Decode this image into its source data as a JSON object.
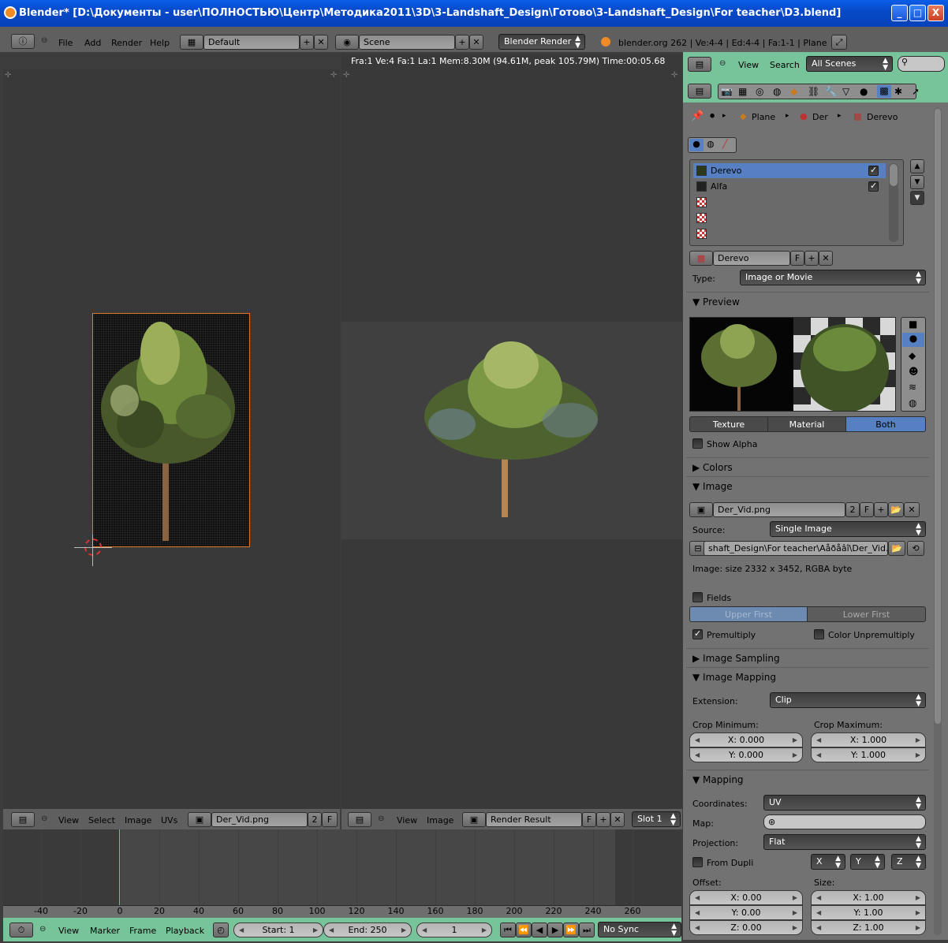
{
  "window": {
    "title": "Blender* [D:\\Документы - user\\ПОЛНОСТЬЮ\\Центр\\Методика2011\\3D\\3-Landshaft_Design\\Готово\\3-Landshaft_Design\\For teacher\\D3.blend]",
    "min": "_",
    "max": "□",
    "close": "X"
  },
  "info_header": {
    "menus": [
      "File",
      "Add",
      "Render",
      "Help"
    ],
    "screen_layout": "Default",
    "scene": "Scene",
    "render_engine": "Blender Render",
    "stats": "blender.org 262 | Ve:4-4 | Ed:4-4 | Fa:1-1 | Plane"
  },
  "render_stats": "Fra:1  Ve:4 Fa:1 La:1 Mem:8.30M (94.61M, peak 105.79M) Time:00:05.68",
  "uv_editor_header": {
    "menus": [
      "View",
      "Select",
      "Image",
      "UVs"
    ],
    "image": "Der_Vid.png",
    "users": "2",
    "fake": "F"
  },
  "image_editor_header": {
    "menus": [
      "View",
      "Image"
    ],
    "image": "Render Result",
    "fake": "F",
    "slot": "Slot 1"
  },
  "timeline": {
    "ticks": [
      "-40",
      "-20",
      "0",
      "20",
      "40",
      "60",
      "80",
      "100",
      "120",
      "140",
      "160",
      "180",
      "200",
      "220",
      "240",
      "260"
    ],
    "menus": [
      "View",
      "Marker",
      "Frame",
      "Playback"
    ],
    "start": "Start: 1",
    "end": "End: 250",
    "current": "1",
    "sync": "No Sync"
  },
  "props_header": {
    "menus": [
      "View",
      "Search"
    ],
    "scenes": "All Scenes"
  },
  "breadcrumb": [
    "Plane",
    "Der",
    "Derevo"
  ],
  "texture_slots": [
    {
      "name": "Derevo",
      "selected": true,
      "checked": true
    },
    {
      "name": "Alfa",
      "selected": false,
      "checked": true
    },
    {
      "name": "",
      "selected": false,
      "checked": false
    },
    {
      "name": "",
      "selected": false,
      "checked": false
    },
    {
      "name": "",
      "selected": false,
      "checked": false
    }
  ],
  "texture": {
    "name": "Derevo",
    "fake": "F",
    "type_label": "Type:",
    "type": "Image or Movie"
  },
  "preview": {
    "section": "Preview",
    "tabs": [
      "Texture",
      "Material",
      "Both"
    ],
    "active_tab": "Both",
    "show_alpha": "Show Alpha"
  },
  "colors": {
    "section": "Colors"
  },
  "image": {
    "section": "Image",
    "file": "Der_Vid.png",
    "users": "2",
    "fake": "F",
    "source_label": "Source:",
    "source": "Single Image",
    "path": "shaft_Design\\For teacher\\Aåðåâî\\Der_Vid.png",
    "info": "Image: size 2332 x 3452, RGBA byte",
    "fields": "Fields",
    "upper_first": "Upper First",
    "lower_first": "Lower First",
    "premultiply": "Premultiply",
    "color_unpremultiply": "Color Unpremultiply"
  },
  "image_sampling": {
    "section": "Image Sampling"
  },
  "image_mapping": {
    "section": "Image Mapping",
    "extension_label": "Extension:",
    "extension": "Clip",
    "crop_min_label": "Crop Minimum:",
    "crop_max_label": "Crop Maximum:",
    "crop_min_x": "X: 0.000",
    "crop_min_y": "Y: 0.000",
    "crop_max_x": "X: 1.000",
    "crop_max_y": "Y: 1.000"
  },
  "mapping": {
    "section": "Mapping",
    "coordinates_label": "Coordinates:",
    "coordinates": "UV",
    "map_label": "Map:",
    "projection_label": "Projection:",
    "projection": "Flat",
    "from_dupli": "From Dupli",
    "axis_x": "X",
    "axis_y": "Y",
    "axis_z": "Z",
    "offset_label": "Offset:",
    "size_label": "Size:",
    "offset_x": "X: 0.00",
    "offset_y": "Y: 0.00",
    "offset_z": "Z: 0.00",
    "size_x": "X: 1.00",
    "size_y": "Y: 1.00",
    "size_z": "Z: 1.00"
  },
  "colors_theme": {
    "accent": "#5680c2",
    "header_green": "#78c49a",
    "title_blue": "#0a5ee9"
  }
}
